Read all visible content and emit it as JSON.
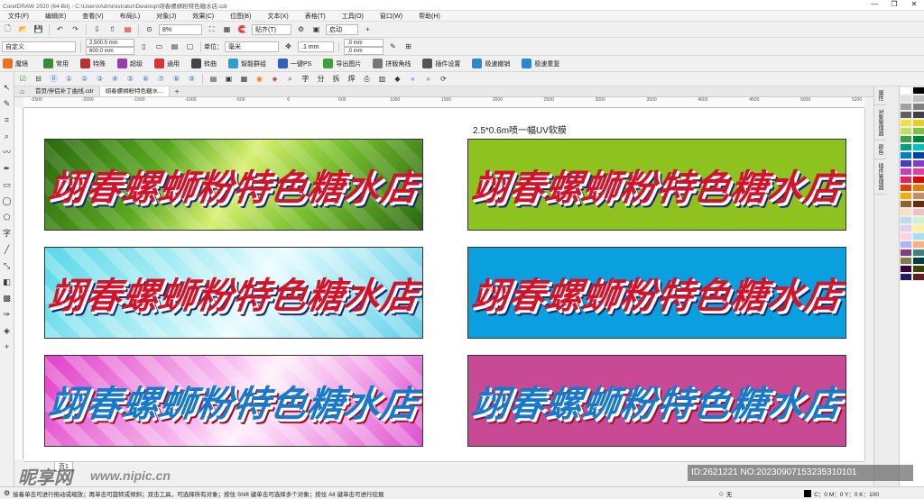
{
  "window": {
    "title": "CorelDRAW 2020 (64-Bit) - C:\\Users\\Administrator\\Desktop\\翊春螺蛳粉特色糖水店.cdr",
    "controls": [
      "—",
      "❐",
      "✕"
    ]
  },
  "menu": [
    "文件(F)",
    "编辑(E)",
    "查看(V)",
    "布局(L)",
    "对象(J)",
    "效果(C)",
    "位图(B)",
    "文本(X)",
    "表格(T)",
    "工具(O)",
    "窗口(W)",
    "帮助(H)"
  ],
  "toolbar1": {
    "zoom": "8%",
    "snap": "贴齐(T)",
    "launch": "启动"
  },
  "toolbar2": {
    "preset": "自定义",
    "width": "2,500.0 mm",
    "height": "600.0 mm",
    "units_label": "单位：",
    "units": "毫米",
    "nudge": ".1 mm",
    "dup_x": ".0 mm",
    "dup_y": ".0 mm"
  },
  "toolbar3": [
    "魔镜",
    "常用",
    "特殊",
    "超级",
    "通用",
    "转曲",
    "智能群组",
    "一键PS",
    "导出图片",
    "拼版角线",
    "插件设置",
    "极速撤销",
    "极速重复"
  ],
  "doc_tabs": [
    "首页/伴侣补丁曲线.cdr",
    "翊春螺蛳粉特色糖水..."
  ],
  "ruler_ticks": [
    "-2500",
    "-2000",
    "-1500",
    "-1000",
    "-500",
    "0",
    "500",
    "1000",
    "1500",
    "2000",
    "2500",
    "3000",
    "3500",
    "4000",
    "4500",
    "5000",
    "5200"
  ],
  "canvas": {
    "caption": "2.5*0.6m喷一幅UV软膜",
    "banners": [
      {
        "text": "翊春螺蛳粉特色糖水店",
        "style": "red"
      },
      {
        "text": "翊春螺蛳粉特色糖水店",
        "style": "red"
      },
      {
        "text": "翊春螺蛳粉特色糖水店",
        "style": "blue"
      },
      {
        "text": "翊春螺蛳粉特色糖水店",
        "style": "red"
      },
      {
        "text": "翊春螺蛳粉特色糖水店",
        "style": "red"
      },
      {
        "text": "翊春螺蛳粉特色糖水店",
        "style": "blue"
      }
    ],
    "colors": {
      "green": "#8dc21f",
      "blue": "#0aa0e0",
      "magenta": "#c84a94"
    }
  },
  "page_bar": {
    "page": "页1"
  },
  "dock_tabs": [
    "属性",
    "对象管理器",
    "颜色",
    "插件管理器"
  ],
  "palette": [
    "#ffffff",
    "#000000",
    "#e0e0e0",
    "#c0c0c0",
    "#a0a0a0",
    "#808080",
    "#606060",
    "#404040",
    "#f0e040",
    "#e8d020",
    "#c0e060",
    "#80c040",
    "#40a040",
    "#008040",
    "#00a080",
    "#00c0c0",
    "#0080c0",
    "#0040a0",
    "#4040c0",
    "#8040c0",
    "#c040c0",
    "#e040a0",
    "#e02060",
    "#e00000",
    "#e04000",
    "#e08000",
    "#f0b000",
    "#c09060",
    "#906030",
    "#603010",
    "#f8e0c0",
    "#f0c0c0",
    "#c0d8f0",
    "#d0f0d0",
    "#e0d0f0",
    "#fff0a0",
    "#ffd0e0",
    "#a0e0f0",
    "#b0b0ff",
    "#ffb080",
    "#804080",
    "#408080",
    "#808040",
    "#004040",
    "#400040",
    "#404000",
    "#202060",
    "#602020"
  ],
  "status": {
    "hint": "接着单击可进行拖动或缩放；再单击可旋转或倾斜；双击工具，可选择所有对象；按住 Shift 键单击可选择多个对象；按住 Alt 键单击可进行挖掘",
    "fill": "无",
    "outline": "C：0 M：0 Y：0 K：100"
  },
  "watermark": {
    "logo": "昵享网",
    "site": "www.nipic.cn",
    "id": "ID:2621221 NO:20230907153235310101"
  }
}
